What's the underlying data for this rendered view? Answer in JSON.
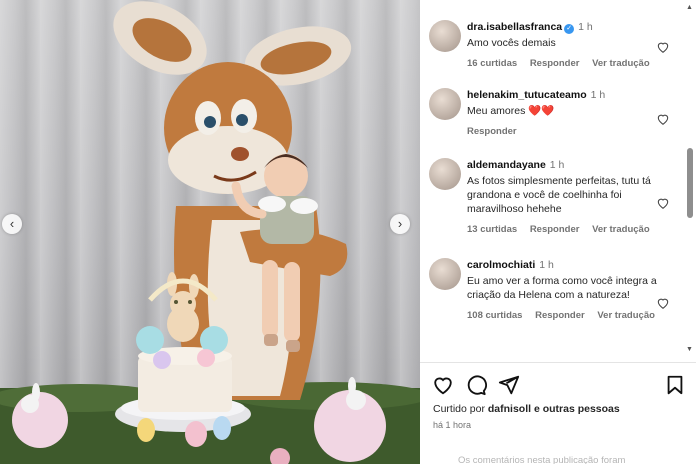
{
  "media": {
    "prev_arrow": "‹",
    "next_arrow": "›"
  },
  "comments": [
    {
      "user": "dra.isabellasfranca",
      "verified": true,
      "time": "1 h",
      "text": "Amo vocês demais",
      "likes": "16 curtidas",
      "reply": "Responder",
      "translate": "Ver tradução"
    },
    {
      "user": "helenakim_tutucateamo",
      "verified": false,
      "time": "1 h",
      "text": "Meu amores",
      "emoji": "❤️❤️",
      "reply": "Responder"
    },
    {
      "user": "aldemandayane",
      "verified": false,
      "time": "1 h",
      "text": "As fotos simplesmente perfeitas, tutu tá grandona e você de coelhinha foi maravilhoso hehehe",
      "likes": "13 curtidas",
      "reply": "Responder",
      "translate": "Ver tradução"
    },
    {
      "user": "carolmochiati",
      "verified": false,
      "time": "1 h",
      "text": "Eu amo ver a forma como você integra a criação da Helena com a natureza!",
      "likes": "108 curtidas",
      "reply": "Responder",
      "translate": "Ver tradução"
    }
  ],
  "footer": {
    "liked_prefix": "Curtido por ",
    "liked_user": "dafnisoll",
    "liked_suffix": " e outras pessoas",
    "posted": "há 1 hora",
    "add_comment_placeholder": "Os comentários nesta publicação foram"
  }
}
